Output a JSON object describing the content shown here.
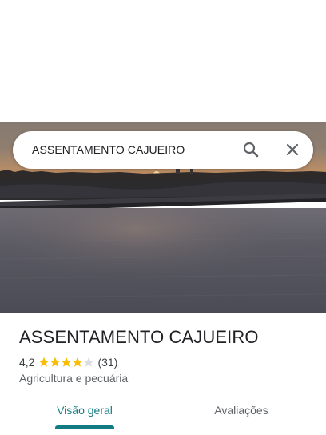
{
  "search": {
    "query": "ASSENTAMENTO CAJUEIRO"
  },
  "icons": {
    "search": "search-icon",
    "close": "close-icon",
    "star": "star-icon"
  },
  "place": {
    "title": "ASSENTAMENTO CAJUEIRO",
    "rating": "4,2",
    "rating_value": 4.2,
    "max_stars": 5,
    "review_count": "(31)",
    "category": "Agricultura e pecuária"
  },
  "tabs": [
    {
      "label": "Visão geral",
      "active": true
    },
    {
      "label": "Avaliações",
      "active": false
    }
  ],
  "colors": {
    "accent": "#137c83",
    "star_filled": "#fbbc04",
    "star_empty": "#dadce0"
  }
}
